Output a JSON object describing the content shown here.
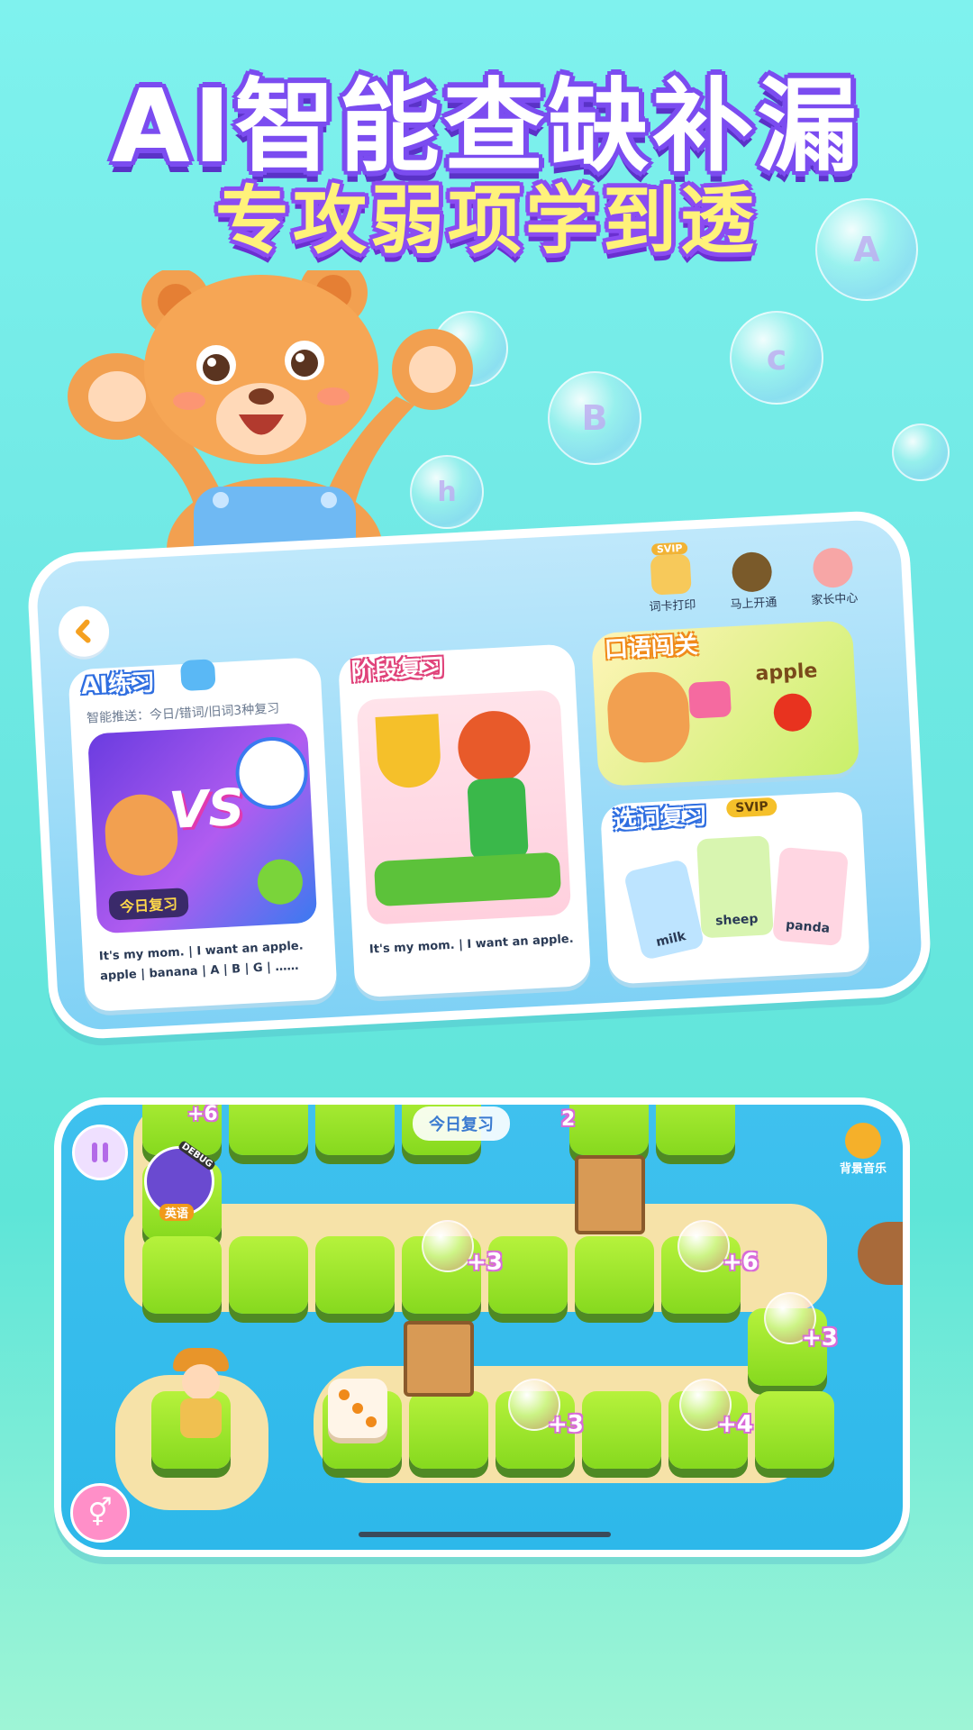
{
  "headline": {
    "line1": "AI智能查缺补漏",
    "line2": "专攻弱项学到透"
  },
  "bubbles": [
    "A",
    "c",
    "B",
    "h"
  ],
  "practice_screen": {
    "top_icons": [
      {
        "label": "词卡打印",
        "badge": "SVIP"
      },
      {
        "label": "马上开通"
      },
      {
        "label": "家长中心"
      }
    ],
    "ai_card": {
      "title": "AI练习",
      "subtitle": "智能推送：今日/错词/旧词3种复习",
      "vs_text": "VS",
      "badge": "今日复习",
      "line1_a": "It's my mom.",
      "line1_b": "I want an apple.",
      "line2": [
        "apple",
        "banana",
        "A",
        "B",
        "G",
        "……"
      ]
    },
    "stage_card": {
      "title": "阶段复习",
      "line_a": "It's my mom.",
      "line_b": "I want an apple."
    },
    "oral_card": {
      "title": "口语闯关",
      "word": "apple"
    },
    "word_card": {
      "title": "选词复习",
      "badge": "SVIP",
      "cards": [
        "milk",
        "sheep",
        "panda"
      ]
    }
  },
  "game_screen": {
    "top_label": "今日复习",
    "music_label": "背景音乐",
    "debug_label": "DEBUG",
    "subject_label": "英语",
    "bonuses": [
      "+3",
      "+6",
      "+3",
      "+3",
      "+4"
    ],
    "top_numbers": [
      "+6",
      "2"
    ]
  },
  "colors": {
    "headline_stroke": "#7b4cf0",
    "headline_line2_fill": "#fff27a",
    "tile_green": "#9be52a",
    "water_blue": "#3fc1ee"
  }
}
